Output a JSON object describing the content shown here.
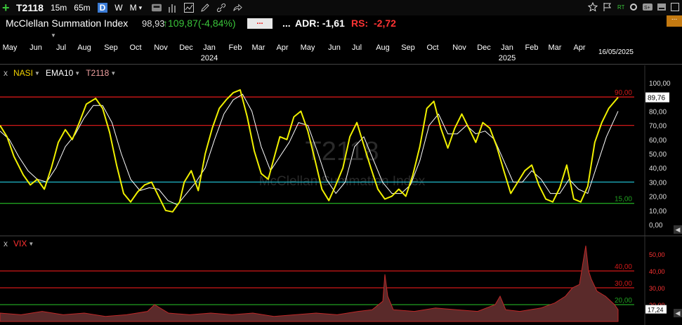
{
  "toolbar": {
    "symbol": "T2118",
    "tf_15m": "15m",
    "tf_65m": "65m",
    "tf_d": "D",
    "tf_w": "W",
    "tf_m": "M"
  },
  "info": {
    "name": "McClellan Summation Index",
    "last": "98,93",
    "change": "109,87(-4,84%)",
    "dots1": "...",
    "dots2": "...",
    "adr": "ADR: -1,61",
    "rs_label": "RS:",
    "rs_value": "-2,72",
    "orange_dots": "..."
  },
  "time_axis": {
    "months": [
      "May",
      "Jun",
      "Jul",
      "Aug",
      "Sep",
      "Oct",
      "Nov",
      "Dec",
      "Jan",
      "Feb",
      "Mar",
      "Apr",
      "May",
      "Jun",
      "Jul",
      "Aug",
      "Sep",
      "Oct",
      "Nov",
      "Dec",
      "Jan",
      "Feb",
      "Mar",
      "Apr"
    ],
    "years": [
      "2024",
      "2025"
    ],
    "end_date": "16/05/2025"
  },
  "pane1": {
    "x": "x",
    "nasi": "NASI",
    "ema": "EMA10",
    "ticker": "T2118",
    "watermark_title": "T2118",
    "watermark_sub": "McClellan Summation Index",
    "last_value_tag": "89,76"
  },
  "pane2": {
    "x": "x",
    "vix": "VIX",
    "last_value_tag": "17,24"
  },
  "colors": {
    "nasi": "#f0f000",
    "ema": "#ffffff",
    "red_level": "#d01818",
    "cyan_level": "#20b8c8",
    "green_level": "#20a020",
    "vix_area": "#5a2a2a",
    "vix_line": "#c02828"
  },
  "chart_data": [
    {
      "type": "line",
      "ylim": [
        0,
        100
      ],
      "y_ticks": [
        "100,00",
        "90,00",
        "80,00",
        "70,00",
        "60,00",
        "50,00",
        "40,00",
        "30,00",
        "20,00",
        "10,00",
        "0,00"
      ],
      "levels": [
        {
          "value": 90,
          "label": "90,00",
          "color": "red"
        },
        {
          "value": 70,
          "label": "",
          "color": "red"
        },
        {
          "value": 30,
          "label": "",
          "color": "cyan"
        },
        {
          "value": 15,
          "label": "15,00",
          "color": "green"
        }
      ],
      "x_range": [
        0,
        24.6
      ],
      "series": [
        {
          "name": "NASI",
          "points": [
            [
              0,
              70
            ],
            [
              0.3,
              62
            ],
            [
              0.6,
              48
            ],
            [
              1.0,
              35
            ],
            [
              1.3,
              28
            ],
            [
              1.6,
              32
            ],
            [
              1.9,
              25
            ],
            [
              2.2,
              40
            ],
            [
              2.5,
              58
            ],
            [
              2.8,
              67
            ],
            [
              3.1,
              60
            ],
            [
              3.4,
              72
            ],
            [
              3.7,
              85
            ],
            [
              4.1,
              89
            ],
            [
              4.4,
              82
            ],
            [
              4.7,
              65
            ],
            [
              5.0,
              42
            ],
            [
              5.3,
              22
            ],
            [
              5.6,
              16
            ],
            [
              5.9,
              23
            ],
            [
              6.2,
              28
            ],
            [
              6.5,
              30
            ],
            [
              6.8,
              20
            ],
            [
              7.1,
              10
            ],
            [
              7.4,
              9
            ],
            [
              7.7,
              16
            ],
            [
              7.9,
              30
            ],
            [
              8.2,
              38
            ],
            [
              8.5,
              24
            ],
            [
              8.8,
              50
            ],
            [
              9.1,
              68
            ],
            [
              9.4,
              82
            ],
            [
              9.7,
              88
            ],
            [
              10.0,
              93
            ],
            [
              10.3,
              95
            ],
            [
              10.6,
              76
            ],
            [
              10.9,
              52
            ],
            [
              11.2,
              36
            ],
            [
              11.5,
              32
            ],
            [
              11.8,
              50
            ],
            [
              12.0,
              62
            ],
            [
              12.3,
              60
            ],
            [
              12.6,
              76
            ],
            [
              12.9,
              80
            ],
            [
              13.2,
              66
            ],
            [
              13.5,
              46
            ],
            [
              13.8,
              25
            ],
            [
              14.1,
              17
            ],
            [
              14.4,
              28
            ],
            [
              14.7,
              40
            ],
            [
              15.0,
              62
            ],
            [
              15.3,
              72
            ],
            [
              15.6,
              56
            ],
            [
              15.9,
              40
            ],
            [
              16.2,
              25
            ],
            [
              16.5,
              18
            ],
            [
              16.8,
              20
            ],
            [
              17.1,
              25
            ],
            [
              17.4,
              20
            ],
            [
              17.7,
              35
            ],
            [
              18.0,
              55
            ],
            [
              18.3,
              82
            ],
            [
              18.6,
              87
            ],
            [
              18.9,
              68
            ],
            [
              19.2,
              54
            ],
            [
              19.5,
              68
            ],
            [
              19.8,
              78
            ],
            [
              20.1,
              68
            ],
            [
              20.4,
              58
            ],
            [
              20.7,
              72
            ],
            [
              21.0,
              68
            ],
            [
              21.3,
              55
            ],
            [
              21.6,
              38
            ],
            [
              21.9,
              22
            ],
            [
              22.2,
              30
            ],
            [
              22.5,
              38
            ],
            [
              22.8,
              42
            ],
            [
              23.1,
              28
            ],
            [
              23.4,
              18
            ],
            [
              23.7,
              16
            ],
            [
              24.0,
              26
            ],
            [
              24.3,
              42
            ],
            [
              24.6,
              18
            ],
            [
              24.9,
              16
            ],
            [
              25.2,
              27
            ],
            [
              25.5,
              58
            ],
            [
              25.8,
              72
            ],
            [
              26.1,
              82
            ],
            [
              26.5,
              89.76
            ]
          ]
        },
        {
          "name": "EMA10",
          "points": [
            [
              0,
              66
            ],
            [
              0.4,
              60
            ],
            [
              0.8,
              48
            ],
            [
              1.2,
              38
            ],
            [
              1.6,
              32
            ],
            [
              2.0,
              30
            ],
            [
              2.4,
              40
            ],
            [
              2.8,
              55
            ],
            [
              3.2,
              63
            ],
            [
              3.6,
              75
            ],
            [
              4.0,
              84
            ],
            [
              4.4,
              84
            ],
            [
              4.8,
              72
            ],
            [
              5.2,
              50
            ],
            [
              5.6,
              32
            ],
            [
              6.0,
              24
            ],
            [
              6.4,
              26
            ],
            [
              6.8,
              25
            ],
            [
              7.2,
              17
            ],
            [
              7.6,
              14
            ],
            [
              8.0,
              22
            ],
            [
              8.4,
              30
            ],
            [
              8.8,
              40
            ],
            [
              9.2,
              60
            ],
            [
              9.6,
              78
            ],
            [
              10.0,
              88
            ],
            [
              10.4,
              92
            ],
            [
              10.8,
              80
            ],
            [
              11.2,
              55
            ],
            [
              11.6,
              38
            ],
            [
              12.0,
              48
            ],
            [
              12.4,
              58
            ],
            [
              12.8,
              72
            ],
            [
              13.2,
              70
            ],
            [
              13.6,
              52
            ],
            [
              14.0,
              32
            ],
            [
              14.4,
              22
            ],
            [
              14.8,
              30
            ],
            [
              15.2,
              55
            ],
            [
              15.6,
              62
            ],
            [
              16.0,
              46
            ],
            [
              16.4,
              30
            ],
            [
              16.8,
              22
            ],
            [
              17.2,
              22
            ],
            [
              17.6,
              28
            ],
            [
              18.0,
              45
            ],
            [
              18.4,
              70
            ],
            [
              18.8,
              78
            ],
            [
              19.2,
              64
            ],
            [
              19.6,
              64
            ],
            [
              20.0,
              70
            ],
            [
              20.4,
              64
            ],
            [
              20.8,
              66
            ],
            [
              21.2,
              60
            ],
            [
              21.6,
              45
            ],
            [
              22.0,
              30
            ],
            [
              22.4,
              30
            ],
            [
              22.8,
              38
            ],
            [
              23.2,
              32
            ],
            [
              23.6,
              22
            ],
            [
              24.0,
              22
            ],
            [
              24.4,
              32
            ],
            [
              24.8,
              25
            ],
            [
              25.2,
              22
            ],
            [
              25.6,
              42
            ],
            [
              26.0,
              62
            ],
            [
              26.5,
              80
            ]
          ]
        }
      ]
    },
    {
      "type": "area",
      "name": "VIX",
      "y_ticks": [
        "50,00",
        "40,00",
        "30,00",
        "20,00"
      ],
      "levels": [
        {
          "value": 40,
          "label": "40,00",
          "color": "red"
        },
        {
          "value": 30,
          "label": "30,00",
          "color": "red"
        },
        {
          "value": 20,
          "label": "20,00",
          "color": "green"
        }
      ],
      "last_value": 17.24
    }
  ]
}
